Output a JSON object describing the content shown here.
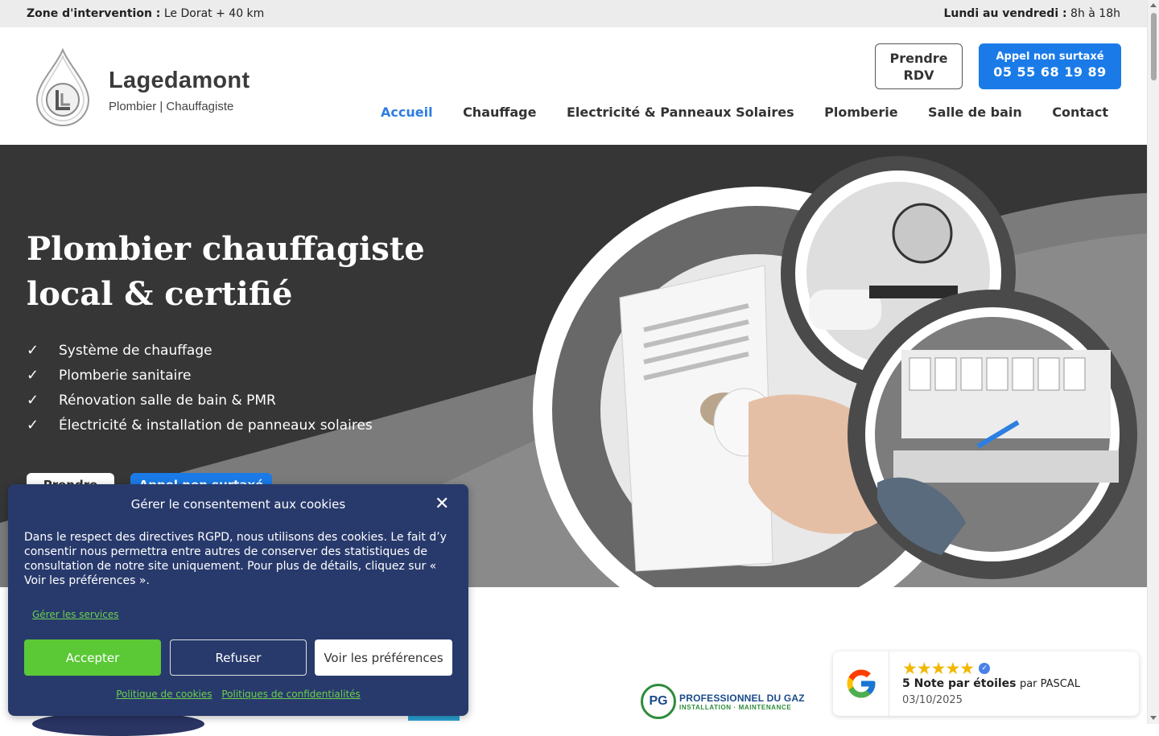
{
  "topbar": {
    "zone_label": "Zone d'intervention :",
    "zone_value": "Le Dorat + 40 km",
    "hours_label": "Lundi au vendredi :",
    "hours_value": "8h à 18h"
  },
  "header": {
    "brand_name": "Lagedamont",
    "brand_sub": "Plombier | Chauffagiste",
    "rdv_button": "Prendre RDV",
    "call_line1": "Appel non surtaxé",
    "call_line2": "05 55 68 19 89"
  },
  "nav": {
    "items": [
      {
        "label": "Accueil"
      },
      {
        "label": "Chauffage"
      },
      {
        "label": "Electricité & Panneaux Solaires"
      },
      {
        "label": "Plomberie"
      },
      {
        "label": "Salle de bain"
      },
      {
        "label": "Contact"
      }
    ]
  },
  "hero": {
    "title_line1": "Plombier chauffagiste",
    "title_line2": "local & certifié",
    "check_icon": "✓",
    "bullets": [
      "Système de chauffage",
      "Plomberie sanitaire",
      "Rénovation salle de bain & PMR",
      "Électricité & installation de panneaux solaires"
    ],
    "btn1": "Prendre",
    "btn2": "Appel non surtaxé"
  },
  "partners": {
    "pg_initials": "PG",
    "pg_line1": "PROFESSIONNEL DU GAZ",
    "pg_line2": "INSTALLATION · MAINTENANCE"
  },
  "review": {
    "stars": "★★★★★",
    "verified_icon": "✓",
    "rating_text": "5 Note par étoiles",
    "by_text": "par PASCAL",
    "date": "03/10/2025"
  },
  "cookie": {
    "title": "Gérer le consentement aux cookies",
    "close_icon": "✕",
    "message": "Dans le respect des directives RGPD, nous utilisons des cookies. Le fait d’y consentir nous permettra entre autres de conserver des statistiques de consultation de notre site uniquement. Pour plus de détails, cliquez sur « Voir les préférences ».",
    "manage_link": "Gérer les services",
    "accept": "Accepter",
    "refuse": "Refuser",
    "preferences": "Voir les préférences",
    "cookie_policy": "Politique de cookies",
    "privacy_policy": "Politiques de confidentialités"
  },
  "colors": {
    "accent_blue": "#1a7be8",
    "hero_dark": "#363636",
    "cookie_bg": "#283a6c",
    "accept_green": "#5bc836",
    "star_gold": "#f2b700"
  }
}
